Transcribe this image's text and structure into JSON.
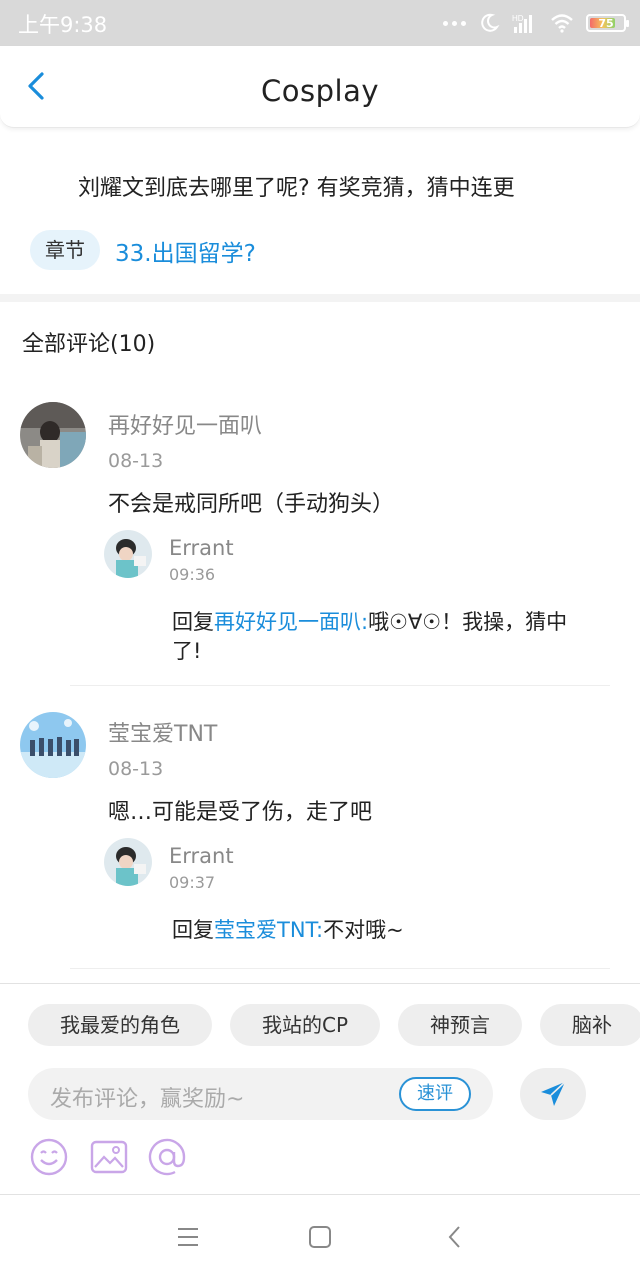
{
  "status_bar": {
    "time": "上午9:38",
    "battery": "75"
  },
  "header": {
    "title": "Cosplay"
  },
  "topic": {
    "text": "刘耀文到底去哪里了呢? 有奖竞猜，猜中连更",
    "chapter_label": "章节",
    "chapter_title": "33.出国留学?"
  },
  "comments_header": "全部评论(10)",
  "comments": [
    {
      "author": "再好好见一面叭",
      "date": "08-13",
      "text": "不会是戒同所吧（手动狗头）",
      "reply": {
        "author": "Errant",
        "time": "09:36",
        "prefix": "回复",
        "mention": "再好好见一面叭:",
        "text": "哦☉∀☉！我操，猜中了!"
      }
    },
    {
      "author": "莹宝爱TNT",
      "date": "08-13",
      "text": "嗯…可能是受了伤，走了吧",
      "reply": {
        "author": "Errant",
        "time": "09:37",
        "prefix": "回复",
        "mention": "莹宝爱TNT:",
        "text": "不对哦~"
      }
    }
  ],
  "input_panel": {
    "tags": [
      "我最爱的角色",
      "我站的CP",
      "神预言",
      "脑补"
    ],
    "placeholder": "发布评论，赢奖励~",
    "quick_comment": "速评",
    "tool_icons": [
      "emoji-icon",
      "image-icon",
      "mention-icon"
    ]
  },
  "nav_icons": [
    "menu-icon",
    "home-square-icon",
    "back-triangle-icon"
  ],
  "colors": {
    "accent": "#1a8ddb",
    "status_bar": "#d9d9d9",
    "tool_icon": "#c9a6e8"
  }
}
